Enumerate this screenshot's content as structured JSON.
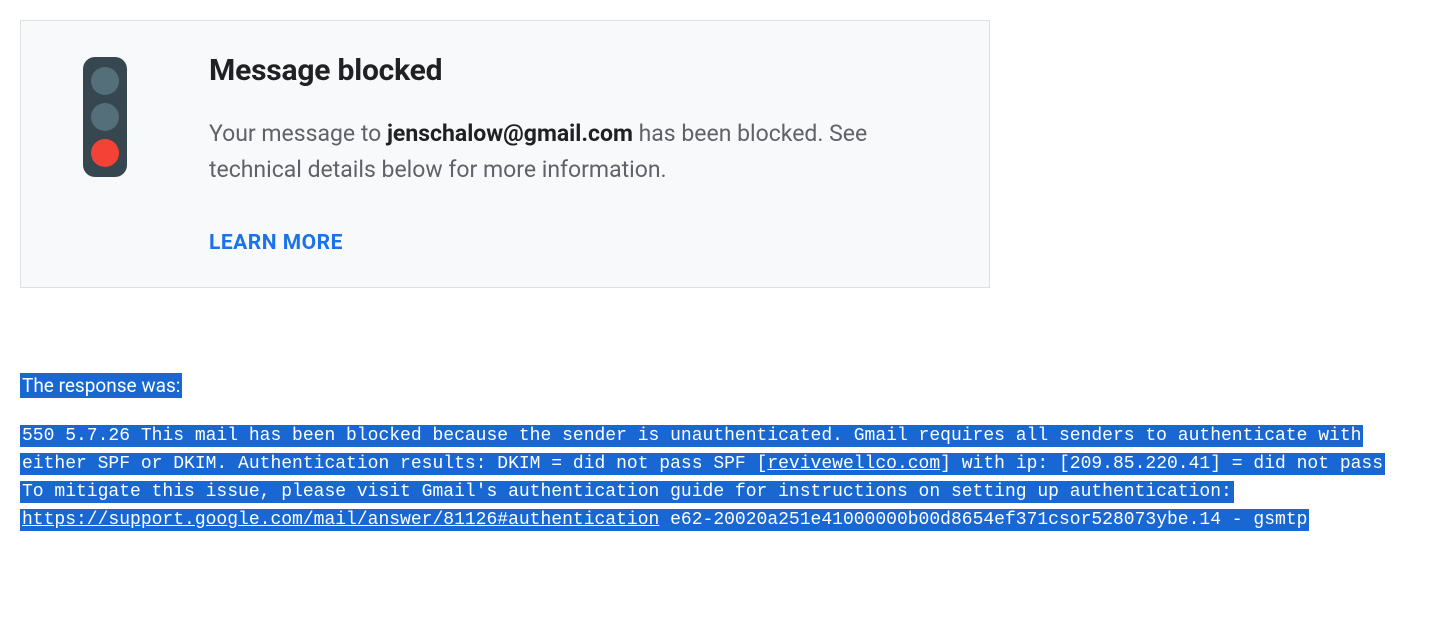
{
  "card": {
    "title": "Message blocked",
    "description_prefix": "Your message to ",
    "email": "jenschalow@gmail.com",
    "description_suffix": " has been blocked. See technical details below for more information.",
    "learn_more": "LEARN MORE"
  },
  "response": {
    "label": "The response was:",
    "line1": "550 5.7.26 This mail has been blocked because the sender is unauthenticated. Gmail requires all senders to authenticate with",
    "line2_prefix": "either SPF or DKIM. Authentication results: DKIM = did not pass SPF [",
    "line2_domain": "revivewellco.com",
    "line2_suffix": "] with ip: [209.85.220.41] = did not pass",
    "line3": "To mitigate this issue, please visit Gmail's authentication guide for instructions on setting up authentication:",
    "line4_url": "https://support.google.com/mail/answer/81126#authentication",
    "line4_suffix": " e62-20020a251e41000000b00d8654ef371csor528073ybe.14 - gsmtp"
  }
}
